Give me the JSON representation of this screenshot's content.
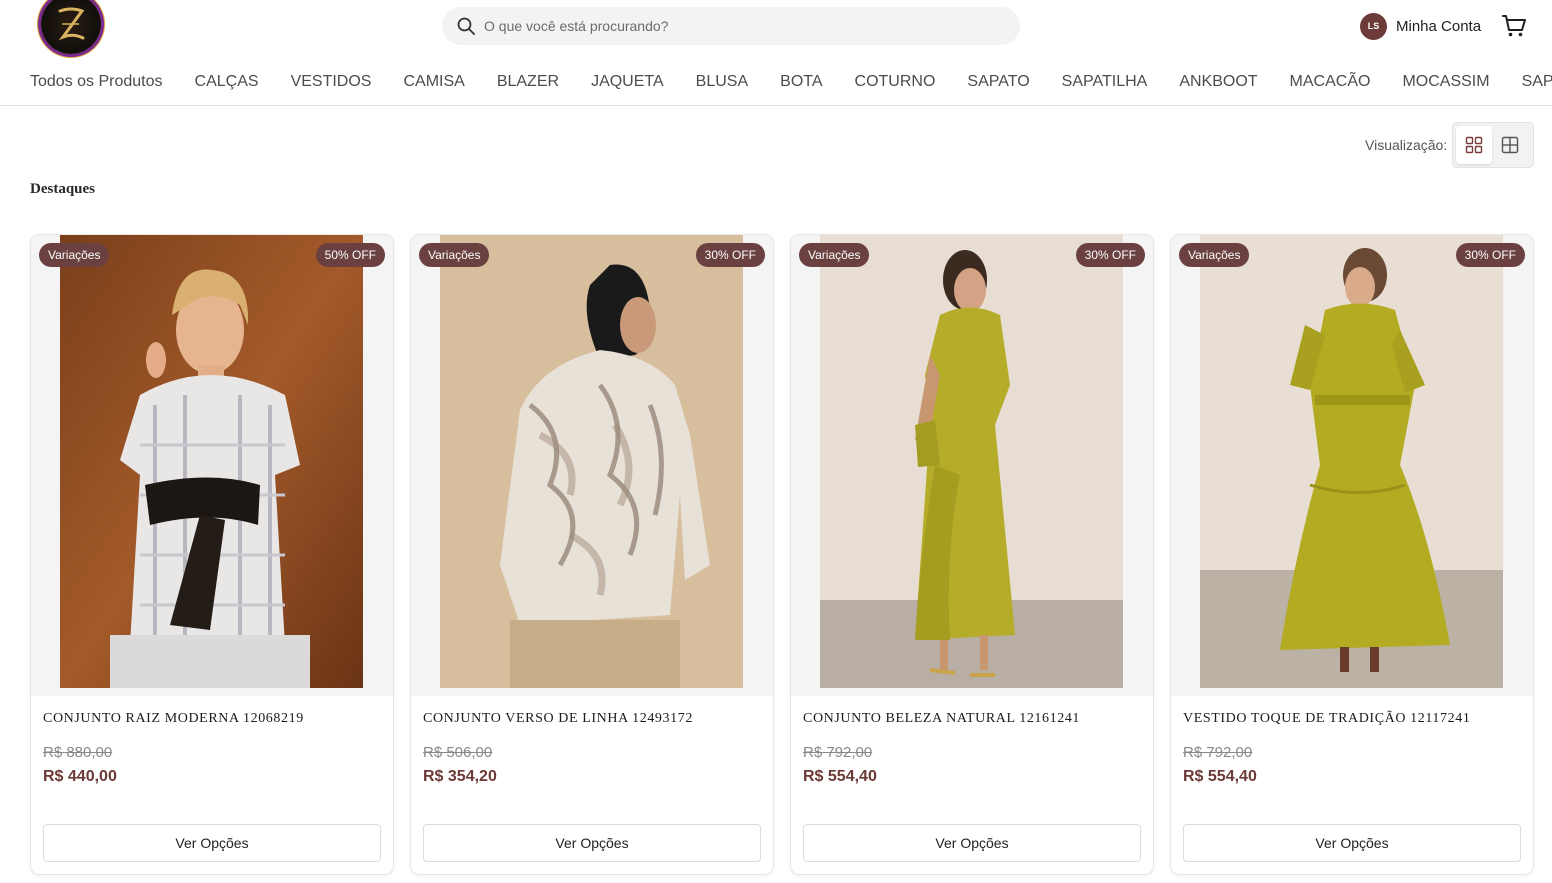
{
  "header": {
    "logo_alt": "Z",
    "search": {
      "placeholder": "O que você está procurando?"
    },
    "account": {
      "initials": "LS",
      "label": "Minha Conta"
    }
  },
  "nav": {
    "items": [
      "Todos os Produtos",
      "CALÇAS",
      "VESTIDOS",
      "CAMISA",
      "BLAZER",
      "JAQUETA",
      "BLUSA",
      "BOTA",
      "COTURNO",
      "SAPATO",
      "SAPATILHA",
      "ANKBOOT",
      "MACACÃO",
      "MOCASSIM",
      "SAPATENIS"
    ]
  },
  "view": {
    "label": "Visualização:",
    "active": "grid-4"
  },
  "section": {
    "title": "Destaques"
  },
  "colors": {
    "accent": "#6a4040",
    "price": "#6b3a36",
    "avatar": "#6e3b3b"
  },
  "products": [
    {
      "badge_left": "Variações",
      "badge_right": "50% OFF",
      "title": "CONJUNTO RAIZ MODERNA 12068219",
      "old_price": "R$ 880,00",
      "price": "R$ 440,00",
      "button": "Ver Opções"
    },
    {
      "badge_left": "Variações",
      "badge_right": "30% OFF",
      "title": "CONJUNTO VERSO DE LINHA 12493172",
      "old_price": "R$ 506,00",
      "price": "R$ 354,20",
      "button": "Ver Opções"
    },
    {
      "badge_left": "Variações",
      "badge_right": "30% OFF",
      "title": "CONJUNTO BELEZA NATURAL 12161241",
      "old_price": "R$ 792,00",
      "price": "R$ 554,40",
      "button": "Ver Opções"
    },
    {
      "badge_left": "Variações",
      "badge_right": "30% OFF",
      "title": "VESTIDO TOQUE DE TRADIÇÃO 12117241",
      "old_price": "R$ 792,00",
      "price": "R$ 554,40",
      "button": "Ver Opções"
    }
  ]
}
